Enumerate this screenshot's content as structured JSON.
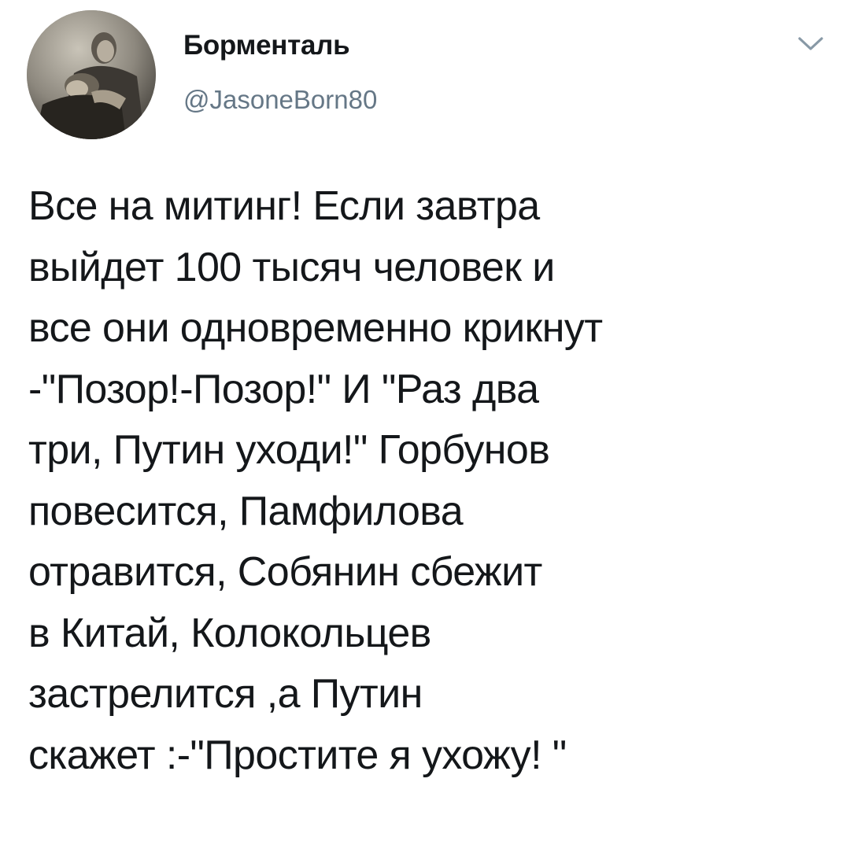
{
  "author": {
    "display_name": "Борменталь",
    "handle": "@JasoneBorn80",
    "avatar_icon": "profile-photo-sepia"
  },
  "menu": {
    "icon": "chevron-down-icon"
  },
  "tweet": {
    "text": "Все на митинг! Если завтра\nвыйдет 100 тысяч человек и\nвсе они одновременно крикнут\n-\"Позор!-Позор!\" И \"Раз два\nтри, Путин уходи!\" Горбунов\nповесится, Памфилова\nотравится, Собянин сбежит\nв Китай, Колокольцев\nзастрелится ,а Путин\nскажет :-\"Простите я ухожу! \""
  },
  "colors": {
    "text": "#14171a",
    "secondary": "#657786",
    "chevron": "#8899a6"
  }
}
